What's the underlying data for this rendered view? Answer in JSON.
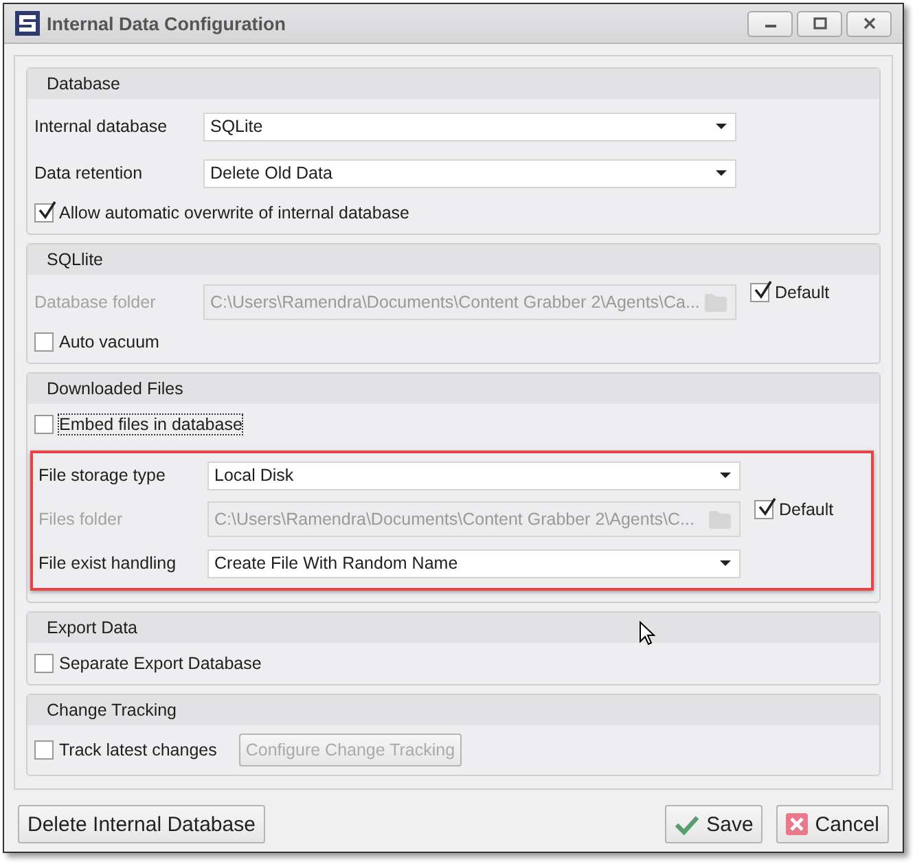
{
  "window": {
    "title": "Internal Data Configuration"
  },
  "sections": [
    {
      "title": "Database",
      "rows": [
        {
          "kind": "select",
          "label": "Internal database",
          "value": "SQLite"
        },
        {
          "kind": "select",
          "label": "Data retention",
          "value": "Delete Old Data"
        },
        {
          "kind": "checkbox",
          "label": "Allow automatic overwrite of internal database",
          "checked": true,
          "focused": false
        }
      ]
    },
    {
      "title": "SQLlite",
      "rows": [
        {
          "kind": "path",
          "label": "Database folder",
          "value": "C:\\Users\\Ramendra\\Documents\\Content Grabber 2\\Agents\\Ca...",
          "disabled": true,
          "default_label": "Default",
          "default_checked": true
        },
        {
          "kind": "checkbox",
          "label": "Auto vacuum",
          "checked": false,
          "focused": false
        }
      ]
    },
    {
      "title": "Downloaded Files",
      "rows": [
        {
          "kind": "checkbox",
          "label": "Embed files in database",
          "checked": false,
          "focused": true
        },
        {
          "kind": "highlight",
          "children": [
            {
              "kind": "select",
              "label": "File storage type",
              "value": "Local Disk"
            },
            {
              "kind": "path",
              "label": "Files folder",
              "value": "C:\\Users\\Ramendra\\Documents\\Content Grabber 2\\Agents\\C...",
              "disabled": true,
              "default_label": "Default",
              "default_checked": true
            },
            {
              "kind": "select",
              "label": "File exist handling",
              "value": "Create File With Random Name"
            }
          ]
        }
      ]
    },
    {
      "title": "Export Data",
      "rows": [
        {
          "kind": "checkbox",
          "label": "Separate Export Database",
          "checked": false,
          "focused": false
        }
      ]
    },
    {
      "title": "Change Tracking",
      "rows": [
        {
          "kind": "checkbox_button",
          "label": "Track latest changes",
          "checked": false,
          "button": {
            "label": "Configure Change Tracking",
            "disabled": true
          }
        }
      ]
    }
  ],
  "footer": {
    "left_button": "Delete Internal Database",
    "buttons": [
      {
        "kind": "save",
        "label": "Save"
      },
      {
        "kind": "cancel",
        "label": "Cancel"
      }
    ]
  }
}
